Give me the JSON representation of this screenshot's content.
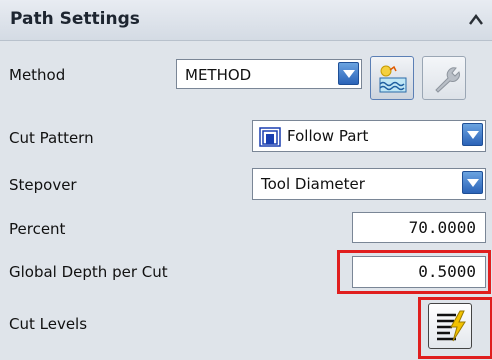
{
  "panel": {
    "title": "Path Settings"
  },
  "rows": {
    "method": {
      "label": "Method",
      "value": "METHOD"
    },
    "cut_pattern": {
      "label": "Cut Pattern",
      "value": "Follow Part"
    },
    "stepover": {
      "label": "Stepover",
      "value": "Tool Diameter"
    },
    "percent": {
      "label": "Percent",
      "value": "70.0000"
    },
    "depth": {
      "label": "Global Depth per Cut",
      "value": "0.5000"
    },
    "cut_levels": {
      "label": "Cut Levels"
    }
  },
  "icons": {
    "collapse": "chevron-up-icon",
    "method_dropdown": "chevron-down-icon",
    "create_method": "create-method-icon",
    "edit_method": "wrench-icon",
    "follow_part_pattern": "follow-part-pattern-icon",
    "cut_levels": "cut-levels-icon"
  },
  "colors": {
    "highlight": "#e01e1e",
    "dropdown_button": "#2b63b8"
  }
}
